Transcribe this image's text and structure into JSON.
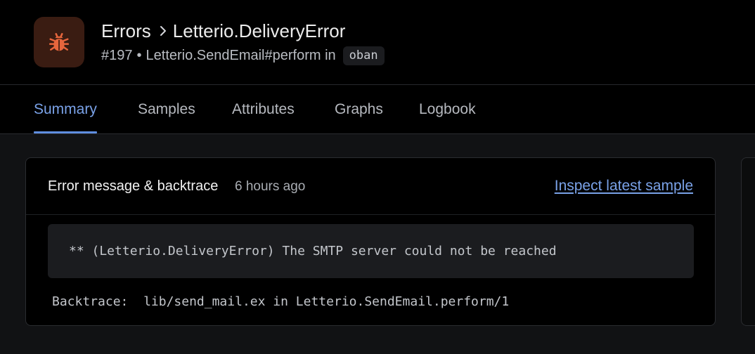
{
  "colors": {
    "accent": "#7aa2e8",
    "error_icon": "#e7663d",
    "error_icon_bg": "#3a1c12"
  },
  "header": {
    "icon": "bug-icon",
    "breadcrumb": {
      "parent": "Errors",
      "current": "Letterio.DeliveryError"
    },
    "subtitle": {
      "incident": "#197",
      "separator": "•",
      "action": "Letterio.SendEmail#perform",
      "in_label": "in",
      "namespace": "oban"
    }
  },
  "tabs": [
    {
      "label": "Summary",
      "active": true
    },
    {
      "label": "Samples",
      "active": false
    },
    {
      "label": "Attributes",
      "active": false
    },
    {
      "label": "Graphs",
      "active": false
    },
    {
      "label": "Logbook",
      "active": false
    }
  ],
  "panel": {
    "title": "Error message & backtrace",
    "time": "6 hours ago",
    "inspect_link": "Inspect latest sample",
    "message": "** (Letterio.DeliveryError) The SMTP server could not be reached",
    "backtrace_label": "Backtrace:",
    "backtrace_value": "lib/send_mail.ex in Letterio.SendEmail.perform/1"
  }
}
